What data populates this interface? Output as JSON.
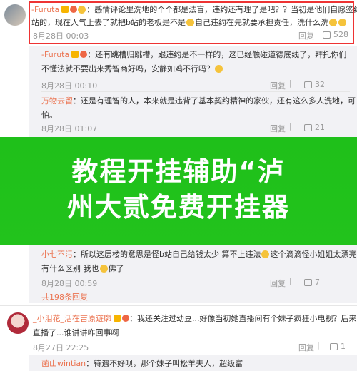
{
  "comments": [
    {
      "user": "-Furuta",
      "text_line1": "：感情评论里洗地的个个都是法盲，违约还有理了是吧？？当初是他们自愿签约b",
      "text_line2": "站的，现在人气上去了就把b站的老板是不是",
      "text_line2b": "自己违约在先就要承担责任，洗什么洗",
      "date": "8月28日 00:03",
      "reply": "回复",
      "likes": "528"
    },
    {
      "user": "-Furuta",
      "text_line1": "：还有跳槽归跳槽，跟违约是不一样的，这已经触碰道德底线了，拜托你们",
      "text_line2": "不懂法就不要出来秀智商好吗，安静如鸡不行吗？",
      "date": "8月28日 00:10",
      "reply": "回复",
      "likes": "32"
    },
    {
      "user": "万物去留",
      "text_line1": "：还是有理智的人，本来就是违背了基本契约精神的家伙，还有这么多人洗地，可",
      "text_line2": "怕。",
      "date": "8月28日 01:07",
      "reply": "回复",
      "likes": "21"
    },
    {
      "user": "小七不污",
      "text_line1": "：所以这层楼的意思是怪b站自己给钱太少 算不上违法",
      "text_line1b": "这个滴滴怪小姐姐太漂亮",
      "text_line2": "有什么区别 我也",
      "text_line2b": "佛了",
      "date": "8月28日 00:59",
      "reply": "回复",
      "likes": "7"
    }
  ],
  "more_replies": "共198条回复",
  "comment5": {
    "user": "_小泪花_活在吉原遊廓",
    "text_line1": "：我还关注过幼豆...好像当初她直播间有个妹子疯狂小电视？后来就不",
    "text_line2": "直播了...谁讲讲咋回事啊",
    "date": "8月27日 22:25",
    "reply": "回复",
    "likes": "1"
  },
  "comment6": {
    "user": "菌山wintian",
    "text_line1": "：待遇不好呗，那个妹子叫松羊夫人，超级富"
  },
  "banner": {
    "line1": "教程开挂辅助“泸",
    "line2": "州大贰免费开挂器"
  },
  "colors": {
    "username": "#eb7350",
    "banner": "#1fc01a",
    "highlight_box": "#e33333"
  }
}
